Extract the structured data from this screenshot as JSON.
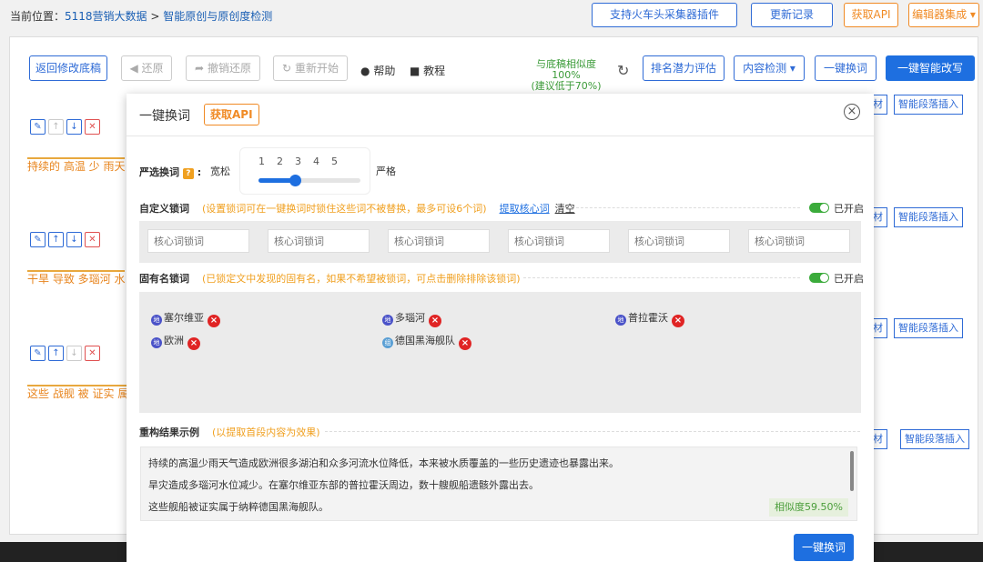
{
  "breadcrumb": {
    "prefix": "当前位置：",
    "link1": "5118营销大数据",
    "separator": ">",
    "link2": "智能原创与原创度检测"
  },
  "top_buttons": {
    "plugin": "支持火车头采集器插件",
    "changelog": "更新记录",
    "api": "获取API",
    "editor": "编辑器集成"
  },
  "toolbar": {
    "back": "返回修改底稿",
    "undo": "还原",
    "redo": "撤销还原",
    "restart": "重新开始",
    "help": "帮助",
    "tutorial": "教程",
    "similarity_line1": "与底稿相似度 100%",
    "similarity_line2": "(建议低于70%)",
    "rank": "排名潜力评估",
    "content_check": "内容检测",
    "one_click": "一键换词",
    "smart_rewrite": "一键智能改写"
  },
  "rows": [
    {
      "text": "持续的 高温 少 雨天"
    },
    {
      "text": "干旱 导致 多瑙河 水"
    },
    {
      "text": "这些 战舰 被 证实 属"
    }
  ],
  "side_buttons": {
    "material": "素材",
    "material_short": "材",
    "paragraph_insert": "智能段落插入"
  },
  "modal": {
    "title": "一键换词",
    "api_button": "获取API",
    "strictness": {
      "label": "严选换词",
      "help_mark": "?",
      "colon": ":",
      "loose": "宽松",
      "strict": "严格",
      "ticks": [
        "1",
        "2",
        "3",
        "4",
        "5"
      ],
      "value": 3
    },
    "custom_lock": {
      "title": "自定义锁词",
      "note": "(设置锁词可在一键换词时锁住这些词不被替换，最多可设6个词)",
      "extract_link": "提取核心词",
      "clear_link": "清空",
      "toggle_label": "已开启",
      "placeholders": [
        "核心词锁词",
        "核心词锁词",
        "核心词锁词",
        "核心词锁词",
        "核心词锁词",
        "核心词锁词"
      ]
    },
    "proper_lock": {
      "title": "固有名锁词",
      "note": "(已锁定文中发现的固有名，如果不希望被锁词，可点击删除排除该锁词)",
      "toggle_label": "已开启",
      "tags": [
        {
          "type": "地",
          "label": "塞尔维亚"
        },
        {
          "type": "地",
          "label": "多瑙河"
        },
        {
          "type": "地",
          "label": "普拉霍沃"
        },
        {
          "type": "地",
          "label": "欧洲"
        },
        {
          "type": "组",
          "label": "德国黑海舰队"
        }
      ]
    },
    "result": {
      "title": "重构结果示例",
      "note": "(以提取首段内容为效果)",
      "lines": [
        "持续的高温少雨天气造成欧洲很多湖泊和众多河流水位降低，本来被水质覆盖的一些历史遗迹也暴露出来。",
        "旱灾造成多瑙河水位减少。在塞尔维亚东部的普拉霍沃周边，数十艘舰船遗骸外露出去。",
        "这些舰船被证实属于纳粹德国黑海舰队。"
      ],
      "similarity": "相似度59.50%"
    },
    "submit": "一键换词"
  }
}
